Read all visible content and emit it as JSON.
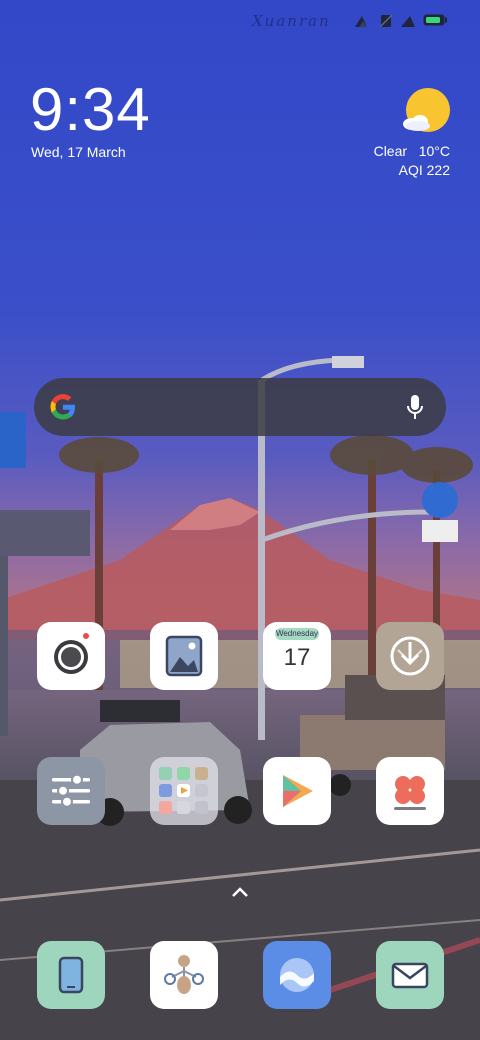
{
  "status_bar": {
    "carrier": "Xuanran",
    "icons": [
      "signal-icon",
      "no-sim-icon",
      "signal-icon",
      "battery-icon"
    ]
  },
  "clock": {
    "time": "9:34",
    "date": "Wed, 17 March"
  },
  "weather": {
    "condition": "Clear",
    "temperature": "10°C",
    "aqi": "AQI 222",
    "icon": "sun-with-cloud-icon"
  },
  "search_bar": {
    "logo": "google-logo-icon",
    "mic": "microphone-icon"
  },
  "home_grid": {
    "rows": [
      [
        {
          "name": "camera",
          "icon": "camera-icon"
        },
        {
          "name": "gallery",
          "icon": "gallery-icon"
        },
        {
          "name": "calendar",
          "icon": "calendar-icon",
          "weekday": "Wednesday",
          "day": "17"
        },
        {
          "name": "security",
          "icon": "shield-download-icon"
        }
      ],
      [
        {
          "name": "settings",
          "icon": "sliders-icon"
        },
        {
          "name": "app-folder",
          "icon": "folder-icon"
        },
        {
          "name": "play-store",
          "icon": "play-icon"
        },
        {
          "name": "themes",
          "icon": "flower-icon"
        }
      ]
    ]
  },
  "dock": [
    {
      "name": "phone",
      "icon": "phone-icon"
    },
    {
      "name": "connect",
      "icon": "nodes-icon"
    },
    {
      "name": "browser",
      "icon": "wave-icon"
    },
    {
      "name": "messages",
      "icon": "envelope-icon"
    }
  ],
  "colors": {
    "accent_mint": "#9ed6bd",
    "browser_blue": "#5b8de6"
  }
}
